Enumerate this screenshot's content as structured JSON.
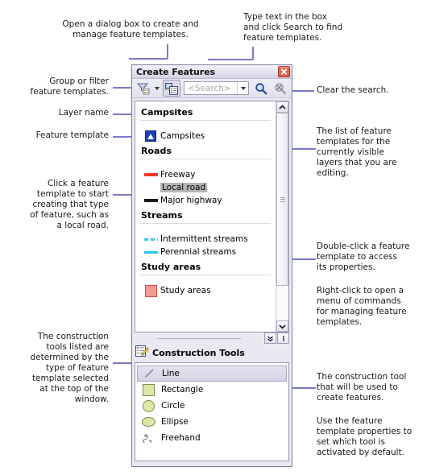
{
  "window": {
    "title": "Create Features",
    "close_icon": "close-icon"
  },
  "toolbar": {
    "filter_icon": "filter-templates-icon",
    "filter_dropdown_icon": "chevron-down-icon",
    "organize_icon": "organize-templates-icon",
    "search_placeholder": "<Search>",
    "search_value": "",
    "search_dropdown_icon": "chevron-down-icon",
    "search_button_icon": "search-icon",
    "clear_search_icon": "clear-search-icon"
  },
  "templates": {
    "groups": [
      {
        "name": "Campsites",
        "items": [
          {
            "label": "Campsites",
            "swatch": "point-marker-blue-triangle",
            "selected": false
          }
        ]
      },
      {
        "name": "Roads",
        "items": [
          {
            "label": "Freeway",
            "swatch": "line-red",
            "selected": false
          },
          {
            "label": "Local road",
            "swatch": "line-none",
            "selected": true
          },
          {
            "label": "Major highway",
            "swatch": "line-black",
            "selected": false
          }
        ]
      },
      {
        "name": "Streams",
        "items": [
          {
            "label": "Intermittent streams",
            "swatch": "line-cyan-dashed",
            "selected": false
          },
          {
            "label": "Perennial streams",
            "swatch": "line-cyan-solid",
            "selected": false
          }
        ]
      },
      {
        "name": "Study areas",
        "items": [
          {
            "label": "Study areas",
            "swatch": "polygon-pink",
            "selected": false
          }
        ]
      }
    ],
    "scrollbar": {
      "up_icon": "chevron-up-icon",
      "down_icon": "chevron-down-icon",
      "grip_icon": "grip-icon"
    }
  },
  "splitter": {
    "collapse_icon": "double-chevron-down-icon",
    "resize_icon": "resize-handle-icon"
  },
  "construction_tools": {
    "icon": "construction-tools-icon",
    "title": "Construction Tools",
    "items": [
      {
        "label": "Line",
        "icon": "line-tool-icon",
        "selected": true
      },
      {
        "label": "Rectangle",
        "icon": "rectangle-tool-icon",
        "selected": false
      },
      {
        "label": "Circle",
        "icon": "circle-tool-icon",
        "selected": false
      },
      {
        "label": "Ellipse",
        "icon": "ellipse-tool-icon",
        "selected": false
      },
      {
        "label": "Freehand",
        "icon": "freehand-tool-icon",
        "selected": false
      }
    ]
  },
  "annotations": {
    "organize": "Open a dialog box to create and\nmanage feature templates.",
    "search": "Type text in the box\nand click Search to find\nfeature templates.",
    "filter": "Group or filter\nfeature templates.",
    "layer_name": "Layer name",
    "feature_template": "Feature template",
    "click_template": "Click a feature\ntemplate to start\ncreating that type\nof feature, such as\na local road.",
    "construction_determined": "The construction\ntools listed are\ndetermined by the\ntype of feature\ntemplate selected\nat the top of the\nwindow.",
    "clear_search": "Clear the search.",
    "list_of_templates": "The list of feature\ntemplates for the\ncurrently visible\nlayers that you are\nediting.",
    "double_click": "Double-click a feature\ntemplate to access\nits properties.",
    "right_click": "Right-click to open a\nmenu of commands\nfor managing feature\ntemplates.",
    "construction_tool_used": "The construction tool\nthat will be used to\ncreate features.",
    "template_properties": "Use the feature\ntemplate properties to\nset which tool is\nactivated by default."
  },
  "colors": {
    "leader": "#7b79c8",
    "selection": "#b6b6b6",
    "window_border": "#7b7f9e"
  }
}
